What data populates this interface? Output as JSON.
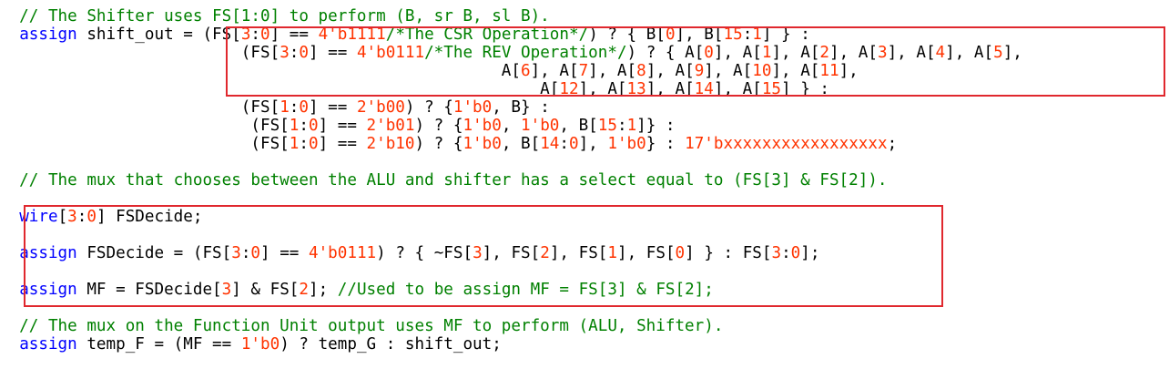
{
  "colors": {
    "keyword": "#0000ff",
    "number": "#ff3300",
    "comment": "#008000",
    "plain": "#000000",
    "highlight_box": "#e0282e"
  },
  "lines": [
    {
      "id": "l01",
      "segments": [
        {
          "c": "cmt",
          "t": "  // The Shifter uses FS[1:0] to perform (B, sr B, sl B)."
        }
      ]
    },
    {
      "id": "l02",
      "segments": [
        {
          "c": "pl",
          "t": "  "
        },
        {
          "c": "kw",
          "t": "assign"
        },
        {
          "c": "pl",
          "t": " shift_out = (FS["
        },
        {
          "c": "num",
          "t": "3"
        },
        {
          "c": "pl",
          "t": ":"
        },
        {
          "c": "num",
          "t": "0"
        },
        {
          "c": "pl",
          "t": "] == "
        },
        {
          "c": "num",
          "t": "4'b1111"
        },
        {
          "c": "cmt",
          "t": "/*The CSR Operation*/"
        },
        {
          "c": "pl",
          "t": ") ? { B["
        },
        {
          "c": "num",
          "t": "0"
        },
        {
          "c": "pl",
          "t": "], B["
        },
        {
          "c": "num",
          "t": "15"
        },
        {
          "c": "pl",
          "t": ":"
        },
        {
          "c": "num",
          "t": "1"
        },
        {
          "c": "pl",
          "t": "] } :"
        }
      ]
    },
    {
      "id": "l03",
      "segments": [
        {
          "c": "pl",
          "t": "                         (FS["
        },
        {
          "c": "num",
          "t": "3"
        },
        {
          "c": "pl",
          "t": ":"
        },
        {
          "c": "num",
          "t": "0"
        },
        {
          "c": "pl",
          "t": "] == "
        },
        {
          "c": "num",
          "t": "4'b0111"
        },
        {
          "c": "cmt",
          "t": "/*The REV Operation*/"
        },
        {
          "c": "pl",
          "t": ") ? { A["
        },
        {
          "c": "num",
          "t": "0"
        },
        {
          "c": "pl",
          "t": "], A["
        },
        {
          "c": "num",
          "t": "1"
        },
        {
          "c": "pl",
          "t": "], A["
        },
        {
          "c": "num",
          "t": "2"
        },
        {
          "c": "pl",
          "t": "], A["
        },
        {
          "c": "num",
          "t": "3"
        },
        {
          "c": "pl",
          "t": "], A["
        },
        {
          "c": "num",
          "t": "4"
        },
        {
          "c": "pl",
          "t": "], A["
        },
        {
          "c": "num",
          "t": "5"
        },
        {
          "c": "pl",
          "t": "],"
        }
      ]
    },
    {
      "id": "l04",
      "segments": [
        {
          "c": "pl",
          "t": "                                                    A["
        },
        {
          "c": "num",
          "t": "6"
        },
        {
          "c": "pl",
          "t": "], A["
        },
        {
          "c": "num",
          "t": "7"
        },
        {
          "c": "pl",
          "t": "], A["
        },
        {
          "c": "num",
          "t": "8"
        },
        {
          "c": "pl",
          "t": "], A["
        },
        {
          "c": "num",
          "t": "9"
        },
        {
          "c": "pl",
          "t": "], A["
        },
        {
          "c": "num",
          "t": "10"
        },
        {
          "c": "pl",
          "t": "], A["
        },
        {
          "c": "num",
          "t": "11"
        },
        {
          "c": "pl",
          "t": "],"
        }
      ]
    },
    {
      "id": "l05",
      "segments": [
        {
          "c": "pl",
          "t": "                                                        A["
        },
        {
          "c": "num",
          "t": "12"
        },
        {
          "c": "pl",
          "t": "], A["
        },
        {
          "c": "num",
          "t": "13"
        },
        {
          "c": "pl",
          "t": "], A["
        },
        {
          "c": "num",
          "t": "14"
        },
        {
          "c": "pl",
          "t": "], A["
        },
        {
          "c": "num",
          "t": "15"
        },
        {
          "c": "pl",
          "t": "] } :"
        }
      ]
    },
    {
      "id": "l06",
      "segments": [
        {
          "c": "pl",
          "t": "                         (FS["
        },
        {
          "c": "num",
          "t": "1"
        },
        {
          "c": "pl",
          "t": ":"
        },
        {
          "c": "num",
          "t": "0"
        },
        {
          "c": "pl",
          "t": "] == "
        },
        {
          "c": "num",
          "t": "2'b00"
        },
        {
          "c": "pl",
          "t": ") ? {"
        },
        {
          "c": "num",
          "t": "1'b0"
        },
        {
          "c": "pl",
          "t": ", B} :"
        }
      ]
    },
    {
      "id": "l07",
      "segments": [
        {
          "c": "pl",
          "t": "                          (FS["
        },
        {
          "c": "num",
          "t": "1"
        },
        {
          "c": "pl",
          "t": ":"
        },
        {
          "c": "num",
          "t": "0"
        },
        {
          "c": "pl",
          "t": "] == "
        },
        {
          "c": "num",
          "t": "2'b01"
        },
        {
          "c": "pl",
          "t": ") ? {"
        },
        {
          "c": "num",
          "t": "1'b0"
        },
        {
          "c": "pl",
          "t": ", "
        },
        {
          "c": "num",
          "t": "1'b0"
        },
        {
          "c": "pl",
          "t": ", B["
        },
        {
          "c": "num",
          "t": "15"
        },
        {
          "c": "pl",
          "t": ":"
        },
        {
          "c": "num",
          "t": "1"
        },
        {
          "c": "pl",
          "t": "]} :"
        }
      ]
    },
    {
      "id": "l08",
      "segments": [
        {
          "c": "pl",
          "t": "                          (FS["
        },
        {
          "c": "num",
          "t": "1"
        },
        {
          "c": "pl",
          "t": ":"
        },
        {
          "c": "num",
          "t": "0"
        },
        {
          "c": "pl",
          "t": "] == "
        },
        {
          "c": "num",
          "t": "2'b10"
        },
        {
          "c": "pl",
          "t": ") ? {"
        },
        {
          "c": "num",
          "t": "1'b0"
        },
        {
          "c": "pl",
          "t": ", B["
        },
        {
          "c": "num",
          "t": "14"
        },
        {
          "c": "pl",
          "t": ":"
        },
        {
          "c": "num",
          "t": "0"
        },
        {
          "c": "pl",
          "t": "], "
        },
        {
          "c": "num",
          "t": "1'b0"
        },
        {
          "c": "pl",
          "t": "} : "
        },
        {
          "c": "num",
          "t": "17'bxxxxxxxxxxxxxxxxx"
        },
        {
          "c": "pl",
          "t": ";"
        }
      ]
    },
    {
      "id": "l09",
      "segments": [
        {
          "c": "pl",
          "t": ""
        }
      ]
    },
    {
      "id": "l10",
      "segments": [
        {
          "c": "cmt",
          "t": "  // The mux that chooses between the ALU and shifter has a select equal to (FS[3] & FS[2])."
        }
      ]
    },
    {
      "id": "l11",
      "segments": [
        {
          "c": "pl",
          "t": ""
        }
      ]
    },
    {
      "id": "l12",
      "segments": [
        {
          "c": "pl",
          "t": "  "
        },
        {
          "c": "kw",
          "t": "wire"
        },
        {
          "c": "pl",
          "t": "["
        },
        {
          "c": "num",
          "t": "3"
        },
        {
          "c": "pl",
          "t": ":"
        },
        {
          "c": "num",
          "t": "0"
        },
        {
          "c": "pl",
          "t": "] FSDecide;"
        }
      ]
    },
    {
      "id": "l13",
      "segments": [
        {
          "c": "pl",
          "t": ""
        }
      ]
    },
    {
      "id": "l14",
      "segments": [
        {
          "c": "pl",
          "t": "  "
        },
        {
          "c": "kw",
          "t": "assign"
        },
        {
          "c": "pl",
          "t": " FSDecide = (FS["
        },
        {
          "c": "num",
          "t": "3"
        },
        {
          "c": "pl",
          "t": ":"
        },
        {
          "c": "num",
          "t": "0"
        },
        {
          "c": "pl",
          "t": "] == "
        },
        {
          "c": "num",
          "t": "4'b0111"
        },
        {
          "c": "pl",
          "t": ") ? { ~FS["
        },
        {
          "c": "num",
          "t": "3"
        },
        {
          "c": "pl",
          "t": "], FS["
        },
        {
          "c": "num",
          "t": "2"
        },
        {
          "c": "pl",
          "t": "], FS["
        },
        {
          "c": "num",
          "t": "1"
        },
        {
          "c": "pl",
          "t": "], FS["
        },
        {
          "c": "num",
          "t": "0"
        },
        {
          "c": "pl",
          "t": "] } : FS["
        },
        {
          "c": "num",
          "t": "3"
        },
        {
          "c": "pl",
          "t": ":"
        },
        {
          "c": "num",
          "t": "0"
        },
        {
          "c": "pl",
          "t": "];"
        }
      ]
    },
    {
      "id": "l15",
      "segments": [
        {
          "c": "pl",
          "t": ""
        }
      ]
    },
    {
      "id": "l16",
      "segments": [
        {
          "c": "pl",
          "t": "  "
        },
        {
          "c": "kw",
          "t": "assign"
        },
        {
          "c": "pl",
          "t": " MF = FSDecide["
        },
        {
          "c": "num",
          "t": "3"
        },
        {
          "c": "pl",
          "t": "] & FS["
        },
        {
          "c": "num",
          "t": "2"
        },
        {
          "c": "pl",
          "t": "]; "
        },
        {
          "c": "cmt",
          "t": "//Used to be assign MF = FS[3] & FS[2];"
        }
      ]
    },
    {
      "id": "l17",
      "segments": [
        {
          "c": "pl",
          "t": ""
        }
      ]
    },
    {
      "id": "l18",
      "segments": [
        {
          "c": "cmt",
          "t": "  // The mux on the Function Unit output uses MF to perform (ALU, Shifter)."
        }
      ]
    },
    {
      "id": "l19",
      "segments": [
        {
          "c": "pl",
          "t": "  "
        },
        {
          "c": "kw",
          "t": "assign"
        },
        {
          "c": "pl",
          "t": " temp_F = (MF == "
        },
        {
          "c": "num",
          "t": "1'b0"
        },
        {
          "c": "pl",
          "t": ") ? temp_G : shift_out;"
        }
      ]
    }
  ]
}
